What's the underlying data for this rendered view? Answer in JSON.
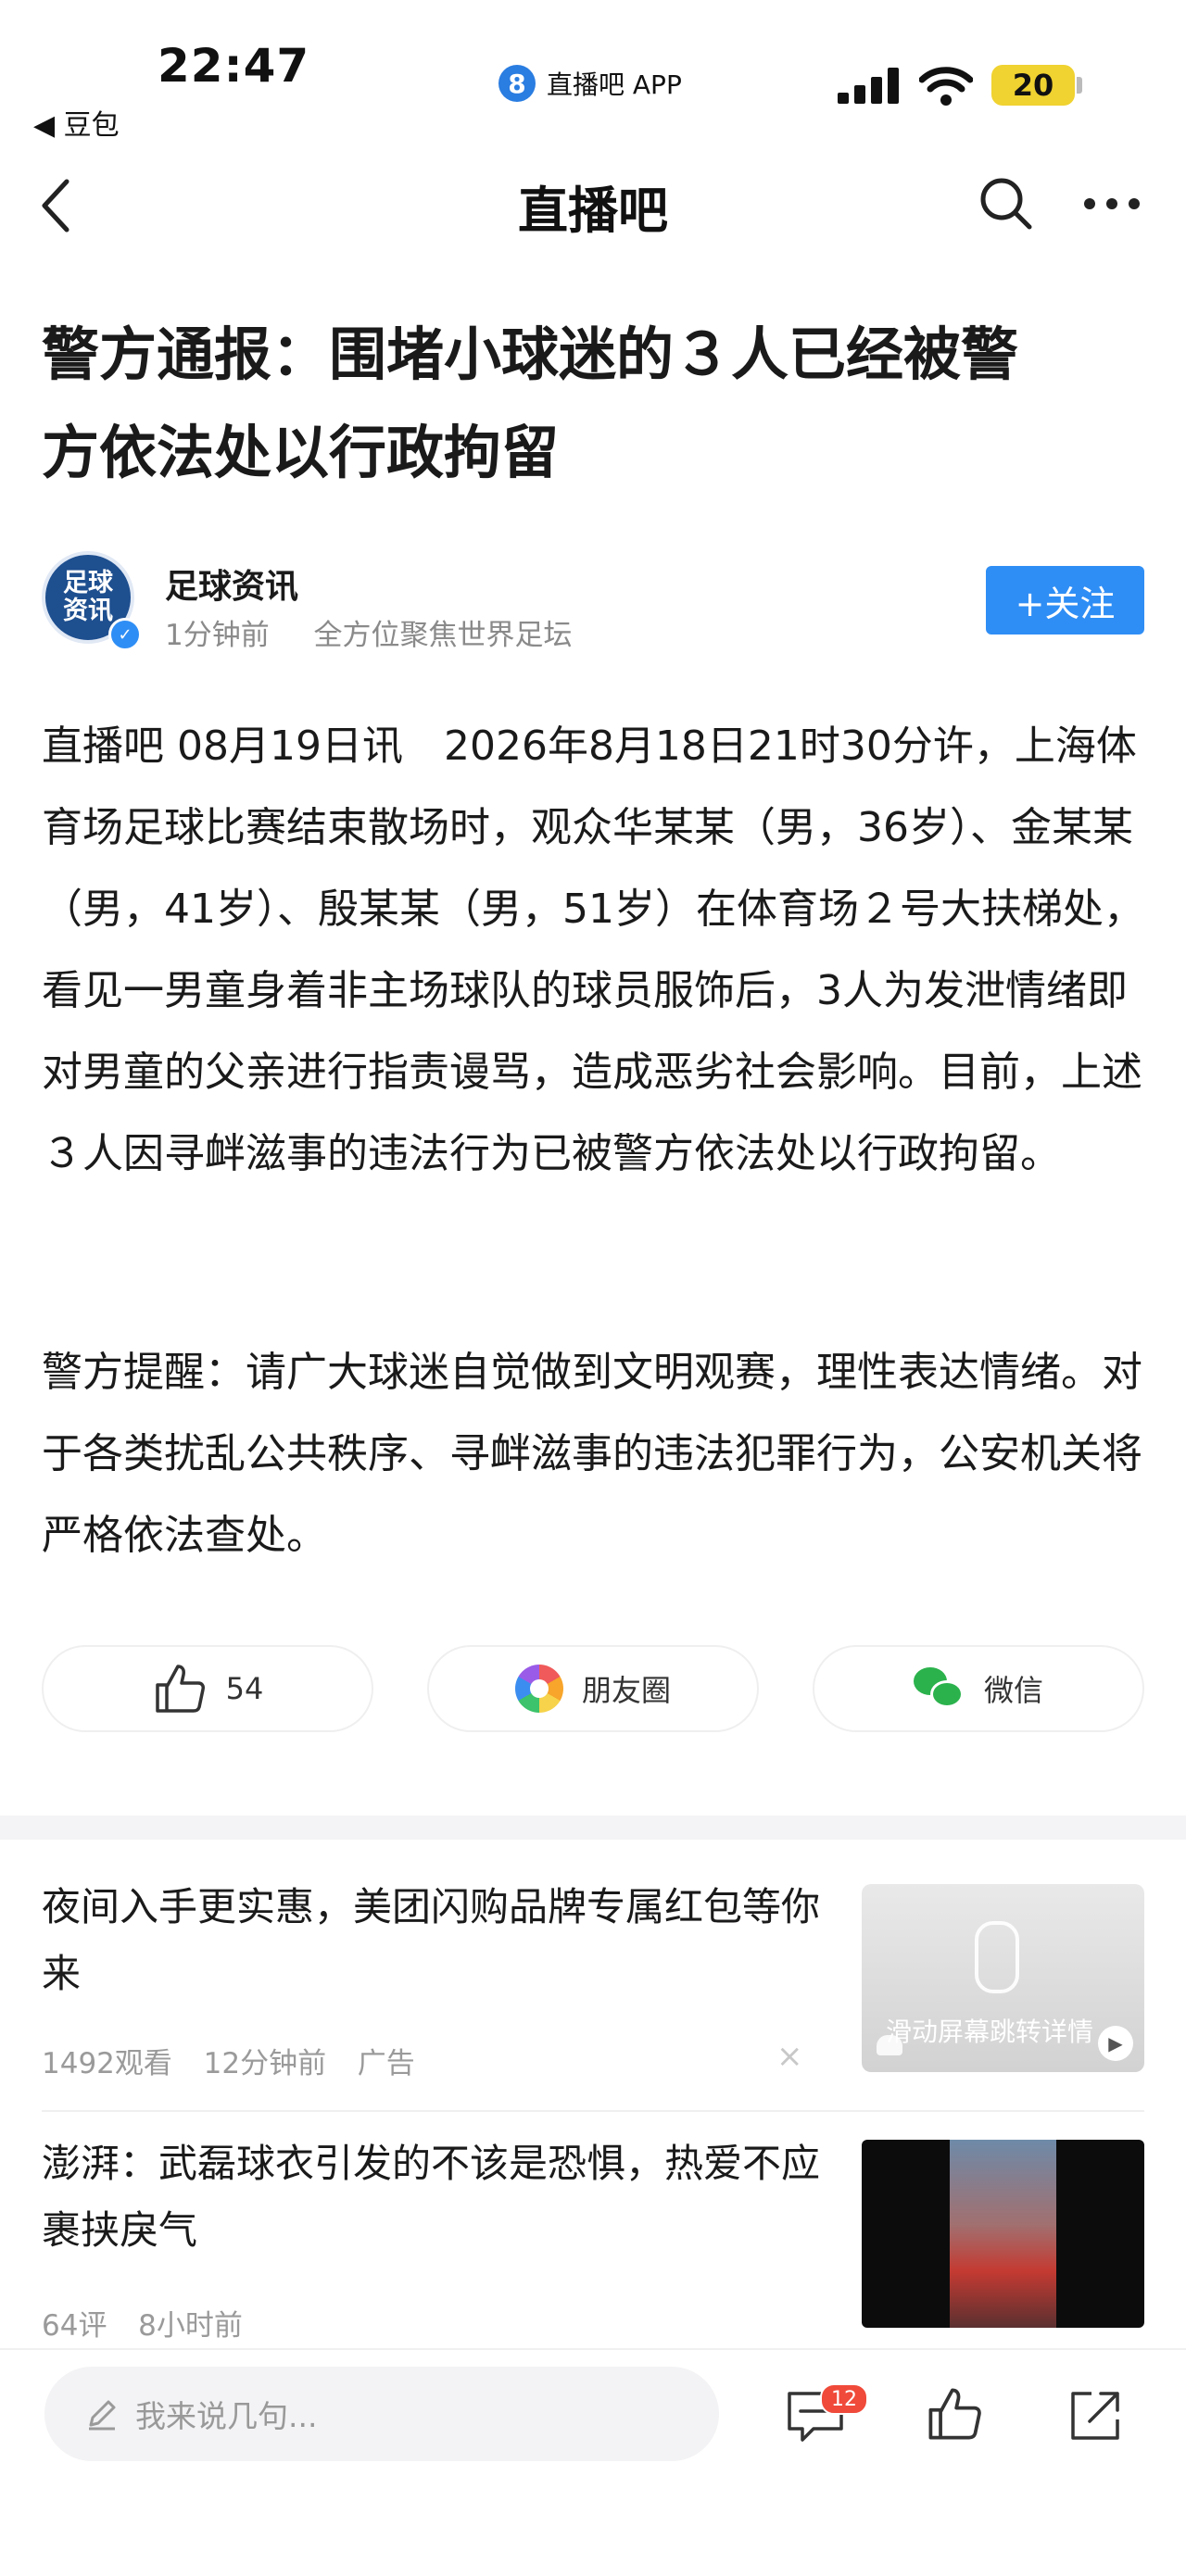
{
  "status_bar": {
    "time": "22:47",
    "back_app": "◀ 豆包",
    "center_app_badge": "8",
    "center_app_name": "直播吧 APP",
    "battery": "20"
  },
  "nav": {
    "title": "直播吧"
  },
  "article": {
    "headline_line1": "警方通报：围堵小球迷的３人已经被警",
    "headline_line2": "方依法处以行政拘留",
    "author": {
      "avatar_text_line1": "足球",
      "avatar_text_line2": "资讯",
      "name": "足球资讯",
      "time_ago": "1分钟前",
      "tagline": "全方位聚焦世界足坛",
      "follow_label": "+关注"
    },
    "paragraph1": "直播吧 08月19日讯　2026年8月18日21时30分许，上海体育场足球比赛结束散场时，观众华某某（男，36岁）、金某某（男，41岁）、殷某某（男，51岁）在体育场２号大扶梯处，看见一男童身着非主场球队的球员服饰后，3人为发泄情绪即对男童的父亲进行指责谩骂，造成恶劣社会影响。目前，上述３人因寻衅滋事的违法行为已被警方依法处以行政拘留。",
    "paragraph2": "警方提醒：请广大球迷自觉做到文明观赛，理性表达情绪。对于各类扰乱公共秩序、寻衅滋事的违法犯罪行为，公安机关将严格依法查处。"
  },
  "share": {
    "like_count": "54",
    "moments_label": "朋友圈",
    "wechat_label": "微信"
  },
  "feed": [
    {
      "title": "夜间入手更实惠，美团闪购品牌专属红包等你来",
      "views": "1492观看",
      "time": "12分钟前",
      "tag": "广告",
      "close": "×",
      "thumb_text": "滑动屏幕跳转详情"
    },
    {
      "title": "澎湃：武磊球衣引发的不该是恐惧，热爱不应裹挟戾气",
      "comments": "64评",
      "time": "8小时前"
    }
  ],
  "bottom_bar": {
    "comment_placeholder": "我来说几句...",
    "message_count": "12"
  },
  "colors": {
    "accent_blue": "#2f8ef5",
    "badge_red": "#f04a3a",
    "battery_yellow": "#f0d230",
    "wechat_green": "#2bb24c"
  }
}
